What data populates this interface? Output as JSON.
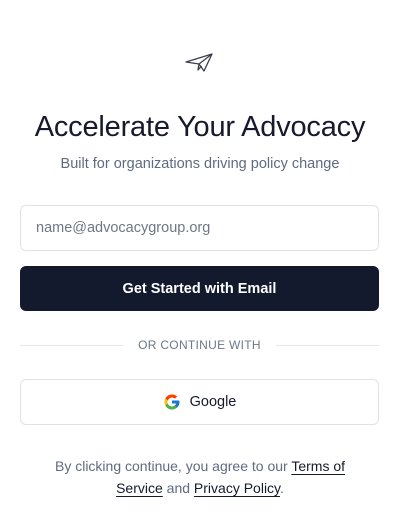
{
  "logo": {
    "icon": "paper-plane-icon"
  },
  "header": {
    "title": "Accelerate Your Advocacy",
    "subtitle": "Built for organizations driving policy change"
  },
  "email": {
    "placeholder": "name@advocacygroup.org",
    "value": ""
  },
  "primary_button": {
    "label": "Get Started with Email"
  },
  "divider": {
    "label": "OR CONTINUE WITH"
  },
  "google_button": {
    "label": "Google",
    "icon": "google-icon"
  },
  "terms": {
    "prefix": "By clicking continue, you agree to our",
    "terms_link": "Terms of Service",
    "conjunction": "and",
    "privacy_link": "Privacy Policy",
    "suffix": "."
  },
  "colors": {
    "primary": "#131a2e",
    "muted_text": "#5f6b80",
    "border": "#dfe3e9"
  }
}
